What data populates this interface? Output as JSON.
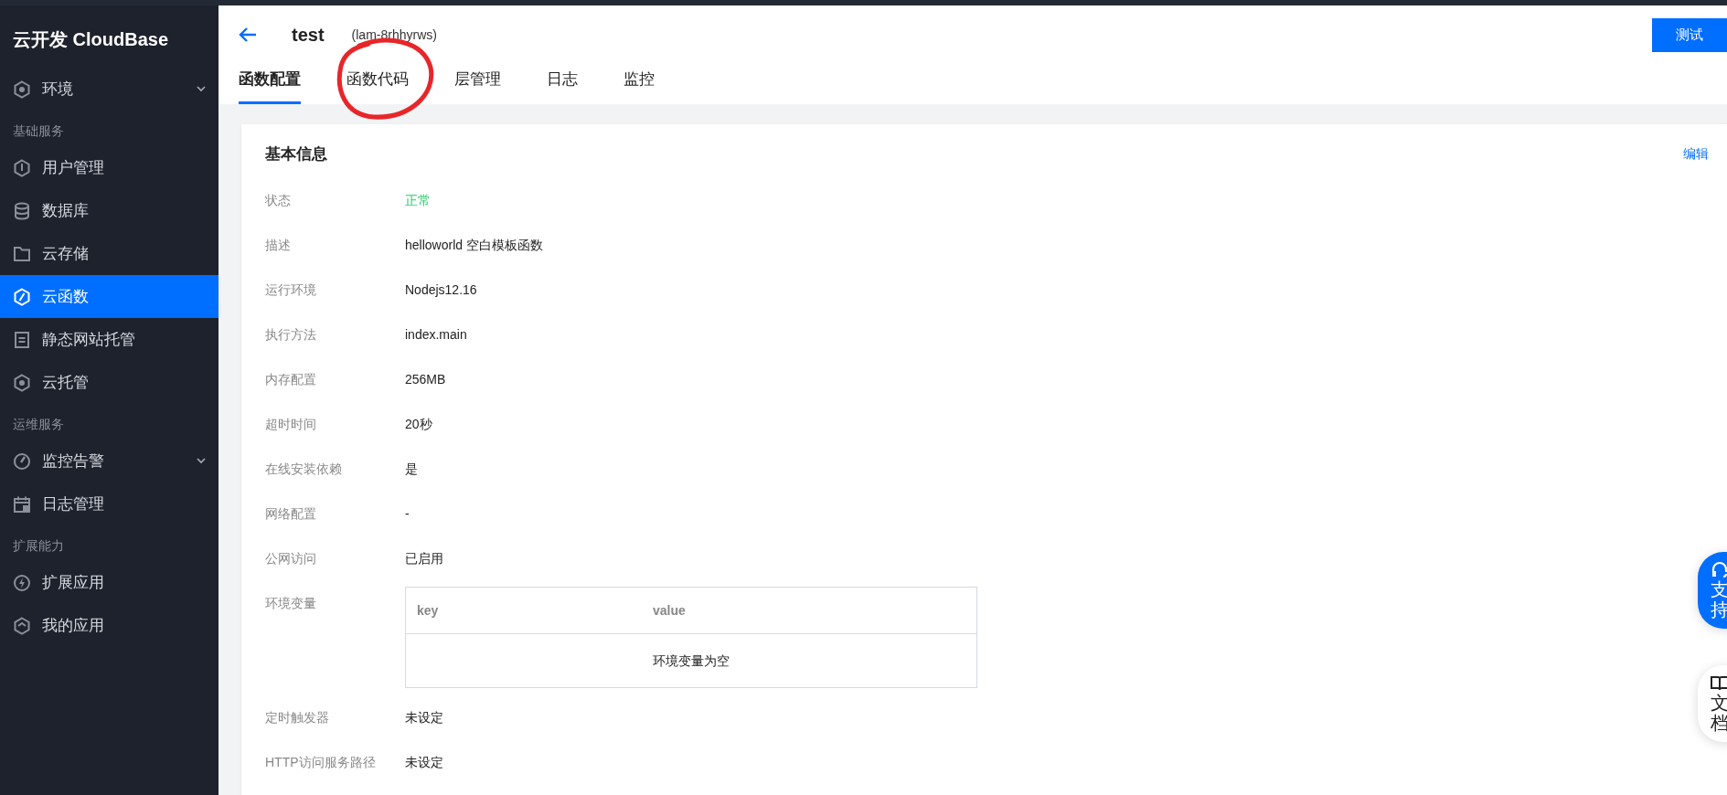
{
  "sidebar": {
    "brand": "云开发 CloudBase",
    "sections": [
      {
        "items": [
          {
            "label": "环境",
            "selected": false,
            "has_submenu": true
          }
        ]
      },
      {
        "heading": "基础服务",
        "items": [
          {
            "label": "用户管理",
            "selected": false,
            "has_submenu": false
          },
          {
            "label": "数据库",
            "selected": false,
            "has_submenu": false
          },
          {
            "label": "云存储",
            "selected": false,
            "has_submenu": false
          },
          {
            "label": "云函数",
            "selected": true,
            "has_submenu": false
          },
          {
            "label": "静态网站托管",
            "selected": false,
            "has_submenu": false
          },
          {
            "label": "云托管",
            "selected": false,
            "has_submenu": false
          }
        ]
      },
      {
        "heading": "运维服务",
        "items": [
          {
            "label": "监控告警",
            "selected": false,
            "has_submenu": true
          },
          {
            "label": "日志管理",
            "selected": false,
            "has_submenu": false
          }
        ]
      },
      {
        "heading": "扩展能力",
        "items": [
          {
            "label": "扩展应用",
            "selected": false,
            "has_submenu": false
          },
          {
            "label": "我的应用",
            "selected": false,
            "has_submenu": false
          }
        ]
      }
    ]
  },
  "header": {
    "title": "test",
    "id": "(lam-8rhhyrws)",
    "test_button": "测试"
  },
  "tabs": [
    {
      "label": "函数配置",
      "selected": true,
      "circled": false
    },
    {
      "label": "函数代码",
      "selected": false,
      "circled": true
    },
    {
      "label": "层管理",
      "selected": false,
      "circled": false
    },
    {
      "label": "日志",
      "selected": false,
      "circled": false
    },
    {
      "label": "监控",
      "selected": false,
      "circled": false
    }
  ],
  "basic_info": {
    "title": "基本信息",
    "edit_link": "编辑",
    "fields": [
      {
        "label": "状态",
        "value": "正常",
        "kind": "status"
      },
      {
        "label": "描述",
        "value": "helloworld 空白模板函数",
        "kind": "text"
      },
      {
        "label": "运行环境",
        "value": "Nodejs12.16",
        "kind": "text"
      },
      {
        "label": "执行方法",
        "value": "index.main",
        "kind": "text"
      },
      {
        "label": "内存配置",
        "value": "256MB",
        "kind": "text"
      },
      {
        "label": "超时时间",
        "value": "20秒",
        "kind": "text"
      },
      {
        "label": "在线安装依赖",
        "value": "是",
        "kind": "text"
      },
      {
        "label": "网络配置",
        "value": "-",
        "kind": "text"
      },
      {
        "label": "公网访问",
        "value": "已启用",
        "kind": "text"
      },
      {
        "label": "环境变量",
        "kind": "table",
        "columns": [
          "key",
          "value"
        ],
        "empty_text": "环境变量为空"
      },
      {
        "label": "定时触发器",
        "value": "未设定",
        "kind": "text"
      },
      {
        "label": "HTTP访问服务路径",
        "value": "未设定",
        "kind": "text"
      }
    ]
  },
  "float_buttons": [
    {
      "label": "支持",
      "kind": "support"
    },
    {
      "label": "文档",
      "kind": "docs"
    }
  ]
}
